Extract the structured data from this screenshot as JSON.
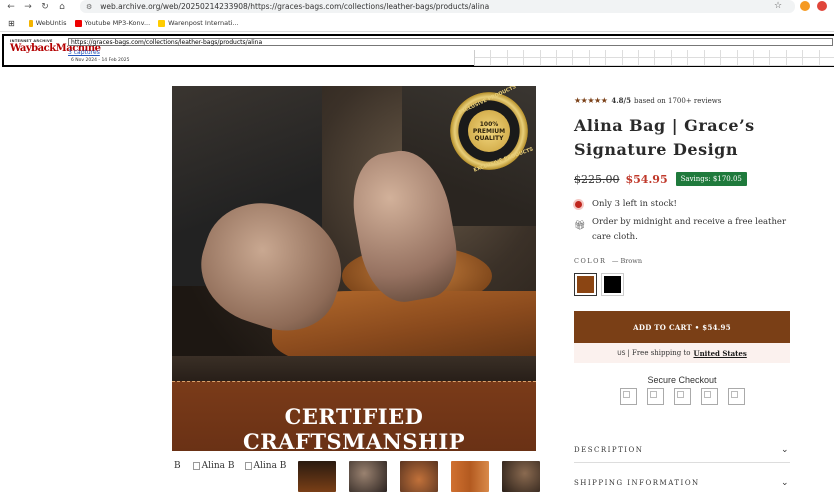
{
  "browser": {
    "url": "web.archive.org/web/20250214233908/https://graces-bags.com/collections/leather-bags/products/alina",
    "bookmarks": [
      "WebUntis",
      "Youtube MP3-Konv...",
      "Warenpost Internati..."
    ]
  },
  "wayback": {
    "logo_top": "INTERNET ARCHIVE",
    "logo_main": "WaybackMachine",
    "url": "https://graces-bags.com/collections/leather-bags/products/alina",
    "captures": "3 captures",
    "dates": "6 Nov 2024 - 14 Feb 2025"
  },
  "image": {
    "banner": "CERTIFIED CRAFTSMANSHIP",
    "badge_top": "EXCLUSIVE PRODUCTS",
    "badge_mid": [
      "100%",
      "PREMIUM",
      "QUALITY"
    ],
    "badge_bottom": "EXCLUSIVE PRODUCTS"
  },
  "thumbnails": {
    "alt_first": "B",
    "alt_2": "Alina B",
    "alt_3": "Alina B"
  },
  "product": {
    "rating_stars": "★★★★★",
    "rating_value": "4.8/5",
    "rating_text": "based on 1700+ reviews",
    "title_line1": "Alina Bag | Grace’s",
    "title_line2": "Signature Design",
    "old_price": "$225.00",
    "new_price": "$54.95",
    "savings": "Savings: $170.05",
    "stock": "Only 3 left in stock!",
    "order": "Order by midnight and receive a free leather care cloth.",
    "color_label": "COLOR",
    "color_value": "— Brown",
    "swatches": [
      "#8b4513",
      "#000000"
    ],
    "add_to_cart": "ADD TO CART • $54.95",
    "ship_us": "US",
    "ship_text": "| Free shipping to",
    "ship_country": "United States",
    "secure": "Secure Checkout",
    "accordion": [
      "DESCRIPTION",
      "SHIPPING INFORMATION"
    ]
  },
  "colors": {
    "accent": "#7a3f16",
    "sale": "#c0392b",
    "savings_bg": "#1f7a3c"
  }
}
